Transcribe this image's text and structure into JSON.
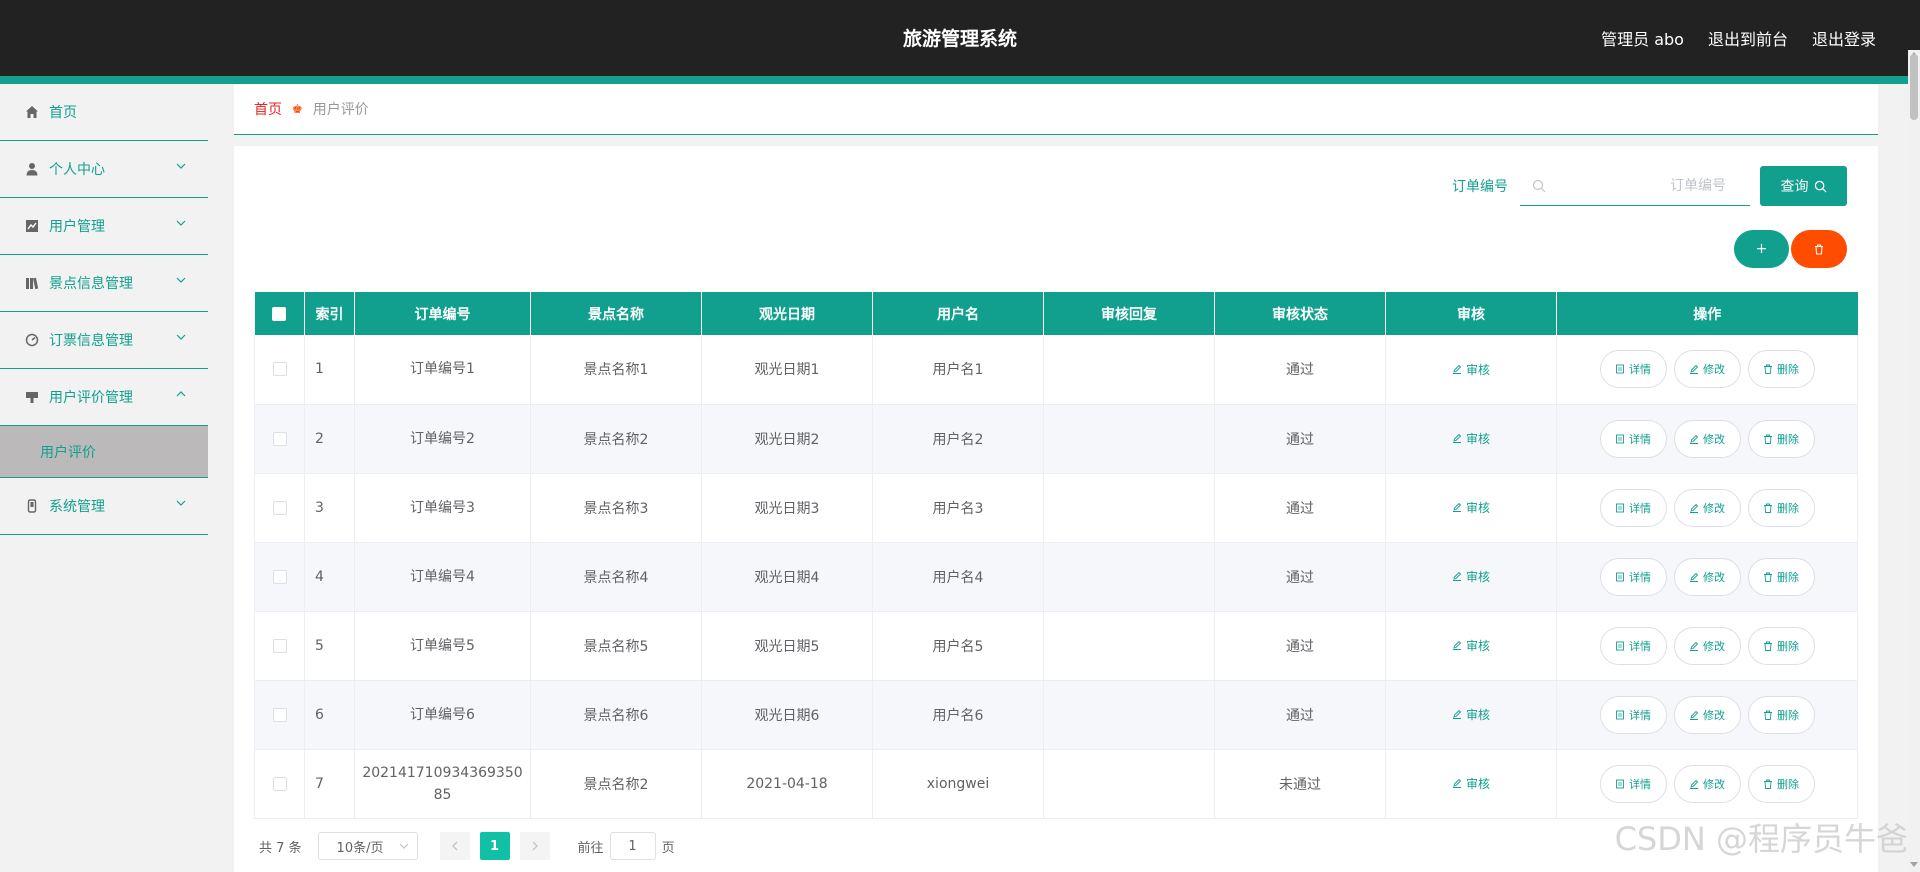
{
  "header": {
    "title": "旅游管理系统",
    "admin": "管理员 abo",
    "to_front": "退出到前台",
    "logout": "退出登录"
  },
  "sidebar": {
    "items": [
      {
        "label": "首页",
        "icon": "home-icon"
      },
      {
        "label": "个人中心",
        "icon": "user-icon"
      },
      {
        "label": "用户管理",
        "icon": "chart-icon"
      },
      {
        "label": "景点信息管理",
        "icon": "books-icon"
      },
      {
        "label": "订票信息管理",
        "icon": "gauge-icon"
      },
      {
        "label": "用户评价管理",
        "icon": "stamp-icon"
      },
      {
        "label": "系统管理",
        "icon": "phone-icon"
      }
    ],
    "active_sub": "用户评价"
  },
  "breadcrumb": {
    "home": "首页",
    "current": "用户评价"
  },
  "search": {
    "label": "订单编号",
    "placeholder": "订单编号",
    "button": "查询",
    "add": "+"
  },
  "table": {
    "headers": [
      "索引",
      "订单编号",
      "景点名称",
      "观光日期",
      "用户名",
      "审核回复",
      "审核状态",
      "审核",
      "操作"
    ],
    "audit_label": "审核",
    "op_labels": {
      "detail": "详情",
      "edit": "修改",
      "delete": "删除"
    },
    "rows": [
      {
        "idx": "1",
        "order": "订单编号1",
        "spot": "景点名称1",
        "date": "观光日期1",
        "user": "用户名1",
        "reply": "",
        "status": "通过"
      },
      {
        "idx": "2",
        "order": "订单编号2",
        "spot": "景点名称2",
        "date": "观光日期2",
        "user": "用户名2",
        "reply": "",
        "status": "通过"
      },
      {
        "idx": "3",
        "order": "订单编号3",
        "spot": "景点名称3",
        "date": "观光日期3",
        "user": "用户名3",
        "reply": "",
        "status": "通过"
      },
      {
        "idx": "4",
        "order": "订单编号4",
        "spot": "景点名称4",
        "date": "观光日期4",
        "user": "用户名4",
        "reply": "",
        "status": "通过"
      },
      {
        "idx": "5",
        "order": "订单编号5",
        "spot": "景点名称5",
        "date": "观光日期5",
        "user": "用户名5",
        "reply": "",
        "status": "通过"
      },
      {
        "idx": "6",
        "order": "订单编号6",
        "spot": "景点名称6",
        "date": "观光日期6",
        "user": "用户名6",
        "reply": "",
        "status": "通过"
      },
      {
        "idx": "7",
        "order": "20214171093436935085",
        "spot": "景点名称2",
        "date": "2021-04-18",
        "user": "xiongwei",
        "reply": "",
        "status": "未通过"
      }
    ]
  },
  "pagination": {
    "total": "共 7 条",
    "page_size": "10条/页",
    "current_page": "1",
    "goto_prefix": "前往",
    "goto_value": "1",
    "goto_suffix": "页"
  },
  "watermark": "CSDN @程序员牛爸",
  "colors": {
    "accent": "#11a08e",
    "danger": "#ff4d00",
    "header_bg": "#222222"
  }
}
